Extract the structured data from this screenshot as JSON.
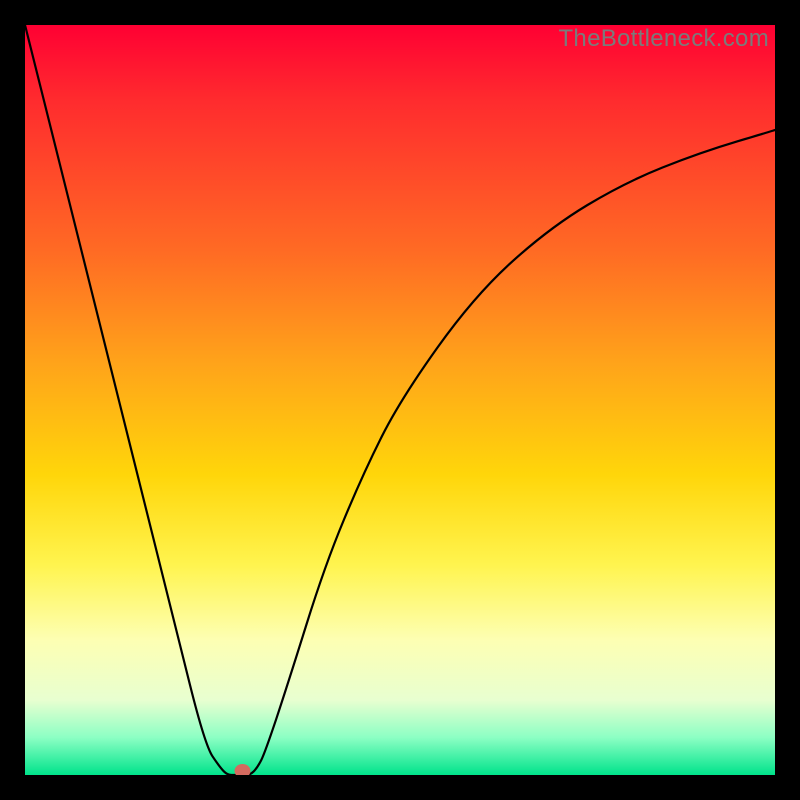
{
  "watermark": "TheBottleneck.com",
  "chart_data": {
    "type": "line",
    "title": "",
    "xlabel": "",
    "ylabel": "",
    "xlim": [
      0,
      100
    ],
    "ylim": [
      0,
      100
    ],
    "series": [
      {
        "name": "bottleneck-curve",
        "x": [
          0,
          5,
          10,
          15,
          20,
          24,
          26,
          27,
          28,
          29,
          30,
          31,
          32,
          35,
          40,
          45,
          50,
          60,
          70,
          80,
          90,
          100
        ],
        "values": [
          100,
          80,
          60,
          40,
          20,
          4,
          1,
          0,
          0,
          0,
          0,
          1,
          3,
          12,
          28,
          40,
          50,
          64,
          73,
          79,
          83,
          86
        ]
      }
    ],
    "marker": {
      "x": 29,
      "y": 0,
      "color": "#d46a5f"
    },
    "gradient_stops": [
      {
        "pos": 0,
        "color": "#ff0033"
      },
      {
        "pos": 10,
        "color": "#ff2b2e"
      },
      {
        "pos": 30,
        "color": "#ff6a24"
      },
      {
        "pos": 45,
        "color": "#ffa31a"
      },
      {
        "pos": 60,
        "color": "#ffd60a"
      },
      {
        "pos": 72,
        "color": "#fff44f"
      },
      {
        "pos": 82,
        "color": "#fdffb3"
      },
      {
        "pos": 90,
        "color": "#e8ffd0"
      },
      {
        "pos": 95,
        "color": "#8cffc4"
      },
      {
        "pos": 100,
        "color": "#00e38b"
      }
    ]
  }
}
